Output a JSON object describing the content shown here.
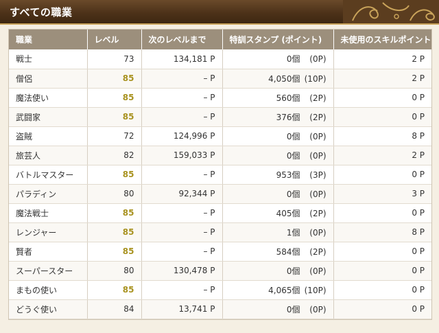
{
  "header": {
    "title": "すべての職業"
  },
  "colors": {
    "max_level": "#a8921f",
    "header_bg": "#4d3219",
    "th_bg": "#9c8f7c"
  },
  "columns": [
    "職業",
    "レベル",
    "次のレベルまで",
    "特訓スタンプ (ポイント)",
    "未使用のスキルポイント"
  ],
  "rows": [
    {
      "job": "戦士",
      "level": "73",
      "max": false,
      "next": "134,181 P",
      "stamps": "0個",
      "stamp_pts": "(0P)",
      "skill": "2 P"
    },
    {
      "job": "僧侶",
      "level": "85",
      "max": true,
      "next": "– P",
      "stamps": "4,050個",
      "stamp_pts": "(10P)",
      "skill": "2 P"
    },
    {
      "job": "魔法使い",
      "level": "85",
      "max": true,
      "next": "– P",
      "stamps": "560個",
      "stamp_pts": "(2P)",
      "skill": "0 P"
    },
    {
      "job": "武闘家",
      "level": "85",
      "max": true,
      "next": "– P",
      "stamps": "376個",
      "stamp_pts": "(2P)",
      "skill": "0 P"
    },
    {
      "job": "盗賊",
      "level": "72",
      "max": false,
      "next": "124,996 P",
      "stamps": "0個",
      "stamp_pts": "(0P)",
      "skill": "8 P"
    },
    {
      "job": "旅芸人",
      "level": "82",
      "max": false,
      "next": "159,033 P",
      "stamps": "0個",
      "stamp_pts": "(0P)",
      "skill": "2 P"
    },
    {
      "job": "バトルマスター",
      "level": "85",
      "max": true,
      "next": "– P",
      "stamps": "953個",
      "stamp_pts": "(3P)",
      "skill": "0 P"
    },
    {
      "job": "パラディン",
      "level": "80",
      "max": false,
      "next": "92,344 P",
      "stamps": "0個",
      "stamp_pts": "(0P)",
      "skill": "3 P"
    },
    {
      "job": "魔法戦士",
      "level": "85",
      "max": true,
      "next": "– P",
      "stamps": "405個",
      "stamp_pts": "(2P)",
      "skill": "0 P"
    },
    {
      "job": "レンジャー",
      "level": "85",
      "max": true,
      "next": "– P",
      "stamps": "1個",
      "stamp_pts": "(0P)",
      "skill": "8 P"
    },
    {
      "job": "賢者",
      "level": "85",
      "max": true,
      "next": "– P",
      "stamps": "584個",
      "stamp_pts": "(2P)",
      "skill": "0 P"
    },
    {
      "job": "スーパースター",
      "level": "80",
      "max": false,
      "next": "130,478 P",
      "stamps": "0個",
      "stamp_pts": "(0P)",
      "skill": "0 P"
    },
    {
      "job": "まもの使い",
      "level": "85",
      "max": true,
      "next": "– P",
      "stamps": "4,065個",
      "stamp_pts": "(10P)",
      "skill": "0 P"
    },
    {
      "job": "どうぐ使い",
      "level": "84",
      "max": false,
      "next": "13,741 P",
      "stamps": "0個",
      "stamp_pts": "(0P)",
      "skill": "0 P"
    }
  ]
}
